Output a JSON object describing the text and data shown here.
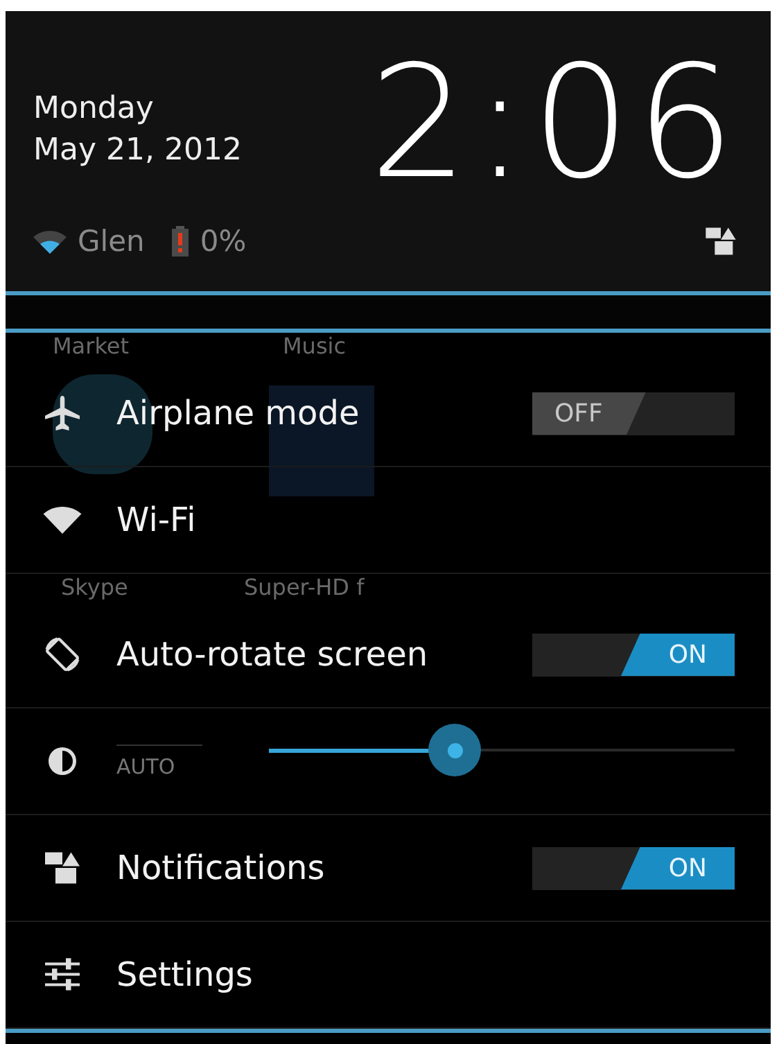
{
  "header": {
    "day": "Monday",
    "date": "May 21, 2012",
    "time": "2:06",
    "network": "Glen",
    "battery": "0%"
  },
  "background_apps": [
    {
      "label": "Market",
      "kind": "plain"
    },
    {
      "label": "Music",
      "kind": "plain"
    },
    {
      "label": "Skype",
      "kind": "skype"
    },
    {
      "label": "Super-HD f",
      "kind": "clapper"
    }
  ],
  "rows": [
    {
      "kind": "toggle",
      "label": "Airplane mode",
      "on": false,
      "state_label": "OFF"
    },
    {
      "kind": "plain",
      "label": "Wi-Fi"
    },
    {
      "kind": "toggle",
      "label": "Auto-rotate screen",
      "on": true,
      "state_label": "ON"
    },
    {
      "kind": "slider",
      "auto_label": "AUTO",
      "level": 0.4
    },
    {
      "kind": "toggle",
      "label": "Notifications",
      "on": true,
      "state_label": "ON"
    },
    {
      "kind": "plain",
      "label": "Settings"
    }
  ]
}
